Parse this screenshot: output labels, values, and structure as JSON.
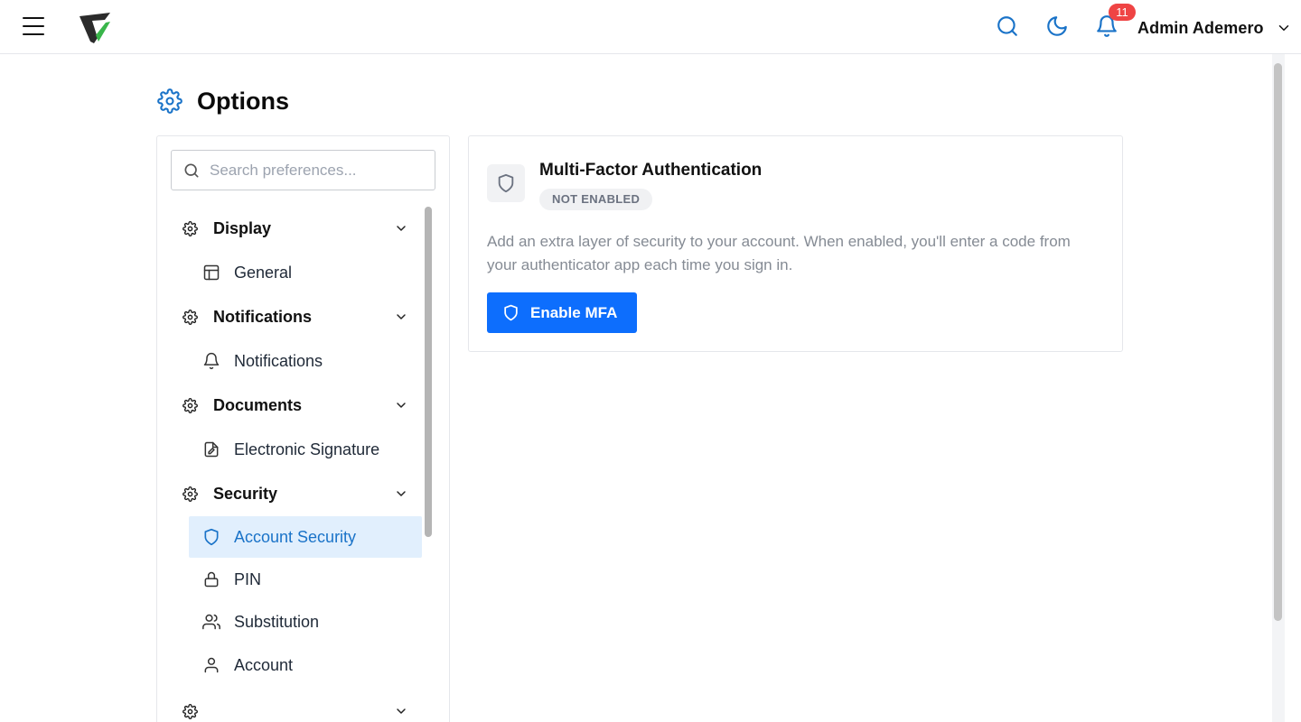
{
  "header": {
    "menu_icon": "hamburger-icon",
    "logo": "app-logo",
    "search_icon": "search-icon",
    "theme_icon": "moon-icon",
    "notifications_icon": "bell-icon",
    "notification_count": "11",
    "user_name": "Admin Ademero",
    "user_menu_icon": "chevron-down-icon"
  },
  "page": {
    "title": "Options",
    "title_icon": "gear-icon"
  },
  "sidebar": {
    "search_placeholder": "Search preferences...",
    "sections": [
      {
        "label": "Display",
        "icon": "gear-icon",
        "expanded": true,
        "items": [
          {
            "label": "General",
            "icon": "layout-icon"
          }
        ]
      },
      {
        "label": "Notifications",
        "icon": "gear-icon",
        "expanded": true,
        "items": [
          {
            "label": "Notifications",
            "icon": "bell-icon"
          }
        ]
      },
      {
        "label": "Documents",
        "icon": "gear-icon",
        "expanded": true,
        "items": [
          {
            "label": "Electronic Signature",
            "icon": "signature-icon"
          }
        ]
      },
      {
        "label": "Security",
        "icon": "gear-icon",
        "expanded": true,
        "items": [
          {
            "label": "Account Security",
            "icon": "shield-icon",
            "active": true
          },
          {
            "label": "PIN",
            "icon": "lock-icon"
          },
          {
            "label": "Substitution",
            "icon": "users-icon"
          },
          {
            "label": "Account",
            "icon": "user-icon"
          }
        ]
      }
    ]
  },
  "mfa": {
    "icon": "shield-icon",
    "title": "Multi-Factor Authentication",
    "status": "NOT ENABLED",
    "description": "Add an extra layer of security to your account. When enabled, you'll enter a code from your authenticator app each time you sign in.",
    "button_label": "Enable MFA",
    "button_icon": "shield-icon"
  },
  "colors": {
    "accent": "#0d6efd",
    "icon_blue": "#1a73c8",
    "active_bg": "#e1effd",
    "badge": "#ef4444"
  }
}
